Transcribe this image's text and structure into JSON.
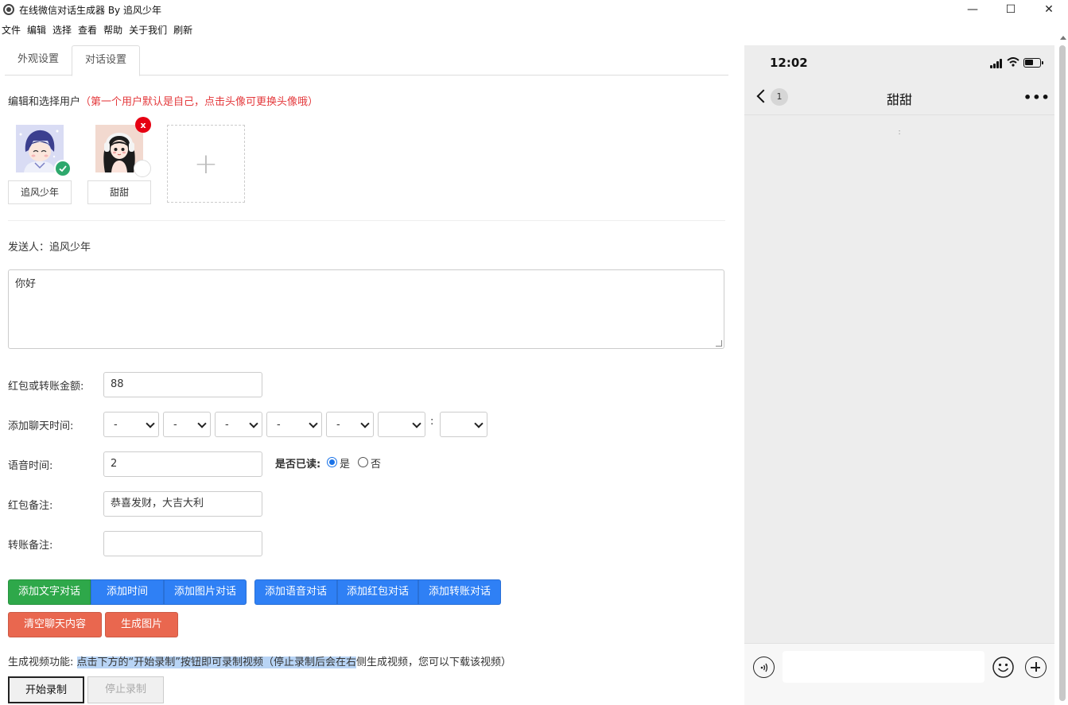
{
  "window": {
    "title": "在线微信对话生成器 By 追风少年",
    "minimize": "—",
    "maximize": "☐",
    "close": "✕"
  },
  "menu": [
    "文件",
    "编辑",
    "选择",
    "查看",
    "帮助",
    "关于我们",
    "刷新"
  ],
  "tabs": {
    "appearance": "外观设置",
    "dialog": "对话设置"
  },
  "users": {
    "title": "编辑和选择用户",
    "hint": "（第一个用户默认是自己，点击头像可更换头像哦）",
    "list": [
      {
        "name": "追风少年",
        "selected": true
      },
      {
        "name": "甜甜",
        "selected": false
      }
    ],
    "delete_label": "x",
    "add_label": "+"
  },
  "sender": {
    "label": "发送人：",
    "name": "追风少年"
  },
  "message": "你好",
  "form": {
    "amount_label": "红包或转账金额:",
    "amount_value": "88",
    "time_label": "添加聊天时间:",
    "time_selects": [
      "-",
      "-",
      "-",
      "-",
      "-",
      "",
      ""
    ],
    "time_colon": ":",
    "voice_label": "语音时间:",
    "voice_value": "2",
    "read_label": "是否已读:",
    "read_yes": "是",
    "read_no": "否",
    "read_value": "是",
    "redpacket_note_label": "红包备注:",
    "redpacket_note_value": "恭喜发财，大吉大利",
    "transfer_note_label": "转账备注:",
    "transfer_note_value": ""
  },
  "buttons": {
    "add_text": "添加文字对话",
    "add_time": "添加时间",
    "add_image": "添加图片对话",
    "add_voice": "添加语音对话",
    "add_redpacket": "添加红包对话",
    "add_transfer": "添加转账对话",
    "clear": "清空聊天内容",
    "generate_image": "生成图片"
  },
  "video": {
    "label": "生成视频功能: ",
    "desc_highlighted": "点击下方的“开始录制”按钮即可录制视频（停止录制后会在右",
    "desc_rest": "侧生成视频，您可以下载该视频）",
    "start": "开始录制",
    "stop": "停止录制"
  },
  "phone": {
    "time": "12:02",
    "unread_count": "1",
    "chat_title": "甜甜",
    "more": "•••",
    "timestamp": ":"
  },
  "colors": {
    "green": "#2ea84a",
    "blue": "#2f80f5",
    "red": "#e9674f",
    "hint_red": "#e4393c",
    "phone_bg": "#ededed"
  }
}
